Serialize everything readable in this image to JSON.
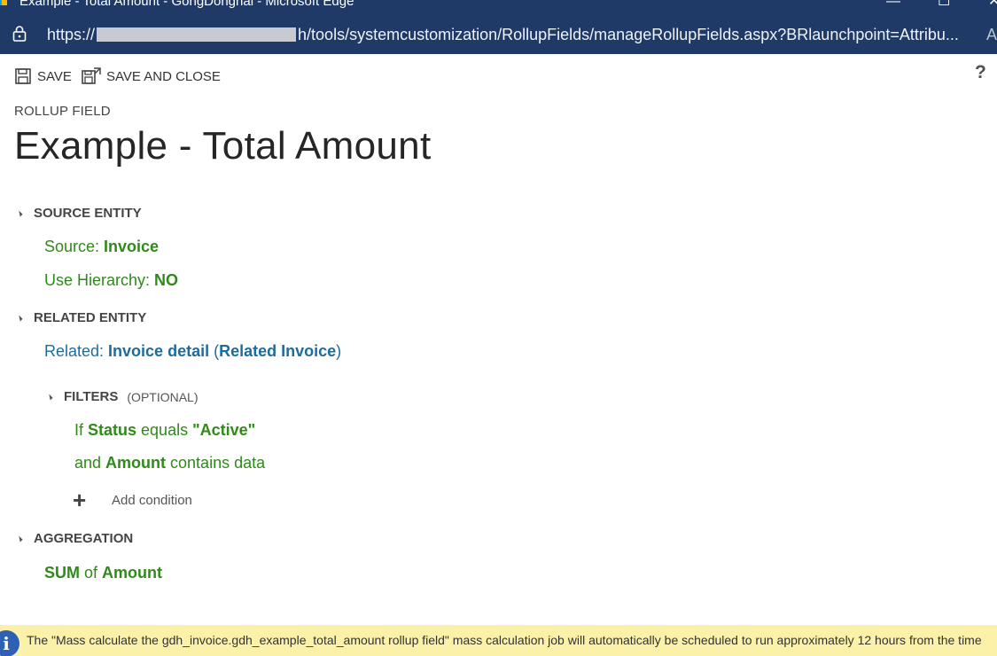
{
  "window": {
    "title": "Example - Total Amount - GongDonghai - Microsoft Edge",
    "minimize_glyph": "—",
    "restore_glyph": "☐",
    "close_glyph": "✕"
  },
  "address_bar": {
    "url_prefix": "https://",
    "url_path": "h/tools/systemcustomization/RollupFields/manageRollupFields.aspx?BRlaunchpoint=Attribu...",
    "reader_glyph": "A"
  },
  "toolbar": {
    "save_label": "SAVE",
    "save_close_label": "SAVE AND CLOSE",
    "help_label": "?"
  },
  "header": {
    "field_type": "ROLLUP FIELD",
    "field_name": "Example - Total Amount"
  },
  "source_entity": {
    "heading": "SOURCE ENTITY",
    "source_label": "Source: ",
    "source_value": "Invoice",
    "hierarchy_label": "Use Hierarchy: ",
    "hierarchy_value": "NO"
  },
  "related_entity": {
    "heading": "RELATED ENTITY",
    "related_label": "Related: ",
    "related_entity": "Invoice detail",
    "open_paren": " (",
    "relationship": "Related Invoice",
    "close_paren": ")"
  },
  "filters": {
    "heading": "FILTERS",
    "optional": "(OPTIONAL)",
    "conditions": [
      {
        "prefix": "If ",
        "field": "Status",
        "operator": " equals ",
        "value": "\"Active\""
      },
      {
        "prefix": "and ",
        "field": "Amount",
        "operator": " contains data",
        "value": ""
      }
    ],
    "add_condition": "Add condition"
  },
  "aggregation": {
    "heading": "AGGREGATION",
    "function": "SUM",
    "of": " of ",
    "field": "Amount"
  },
  "notice": {
    "message": "The \"Mass calculate the gdh_invoice.gdh_example_total_amount rollup field\" mass calculation job will automatically be scheduled to run approximately 12 hours from the time"
  }
}
